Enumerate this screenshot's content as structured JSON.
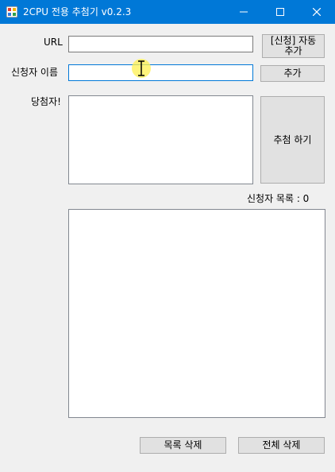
{
  "window": {
    "title": "2CPU 전용 추첨기 v0.2.3",
    "accent_color": "#0078d7",
    "controls": {
      "minimize": "minimize-icon",
      "maximize": "maximize-icon",
      "close": "close-icon"
    }
  },
  "form": {
    "url_label": "URL",
    "url_value": "",
    "applicant_label": "신청자 이름",
    "applicant_value": "",
    "winner_label": "당첨자!",
    "winner_value": "",
    "applicant_list_label": "신청자 목록 : 0",
    "applicant_list_value": ""
  },
  "buttons": {
    "auto_add_line1": "[신청] 자동",
    "auto_add_line2": "추가",
    "add": "추가",
    "draw": "추첨 하기",
    "delete_list": "목록 삭제",
    "delete_all": "전체 삭제"
  }
}
